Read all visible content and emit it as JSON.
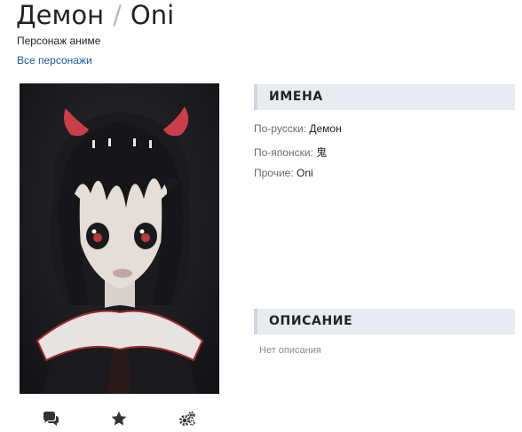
{
  "header": {
    "title_ru": "Демон",
    "separator": "/",
    "title_en": "Oni",
    "subtitle": "Персонаж аниме",
    "back_link": "Все персонажи"
  },
  "poster": {
    "alt": "Демон"
  },
  "actions": [
    {
      "icon": "comments-icon"
    },
    {
      "icon": "star-icon"
    },
    {
      "icon": "gears-icon"
    }
  ],
  "names": {
    "heading": "ИМЕНА",
    "russian_key": "По-русски:",
    "russian_val": "Демон",
    "japanese_key": "По-японски:",
    "japanese_val": "鬼",
    "other_key": "Прочие:",
    "other_val": "Oni"
  },
  "description": {
    "heading": "ОПИСАНИЕ",
    "empty_text": "Нет описания"
  },
  "colors": {
    "link": "#1a5a9a",
    "section_bg": "#e8ebf0",
    "icon": "#333333"
  }
}
